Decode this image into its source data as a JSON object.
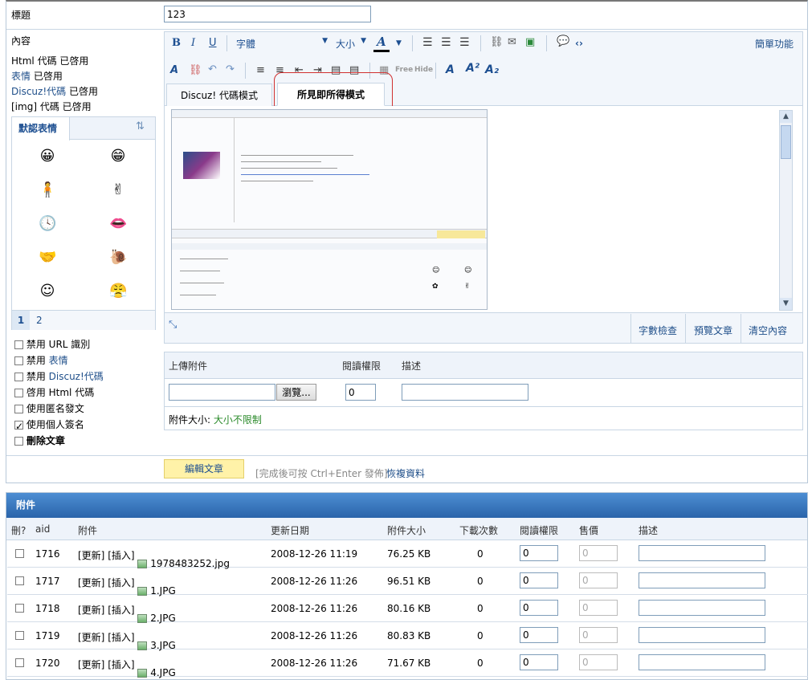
{
  "form": {
    "title_label": "標題",
    "title_value": "123",
    "content_label": "內容",
    "modes": [
      {
        "name": "Html 代碼",
        "status": "已啓用"
      },
      {
        "name": "表情",
        "status": "已啓用"
      },
      {
        "name": "Discuz!代碼",
        "status": "已啓用"
      },
      {
        "name": "[img] 代碼",
        "status": "已啓用"
      }
    ]
  },
  "smilies": {
    "tab_label": "默認表情",
    "icons": [
      "smile-icon",
      "grin-icon",
      "figure-icon",
      "victory-icon",
      "clock-icon",
      "lips-icon",
      "handshake-icon",
      "snail-icon",
      "happy-icon",
      "angry-icon"
    ],
    "pages": [
      "1",
      "2"
    ]
  },
  "options": [
    {
      "pre": "禁用",
      "link": "",
      "text": " URL 識別",
      "checked": false
    },
    {
      "pre": "禁用 ",
      "link": "表情",
      "text": "",
      "checked": false
    },
    {
      "pre": "禁用 ",
      "link": "Discuz!代碼",
      "text": "",
      "checked": false
    },
    {
      "pre": "啓用 Html 代碼",
      "link": "",
      "text": "",
      "checked": false
    },
    {
      "pre": "使用匿名發文",
      "link": "",
      "text": "",
      "checked": false
    },
    {
      "pre": "使用個人簽名",
      "link": "",
      "text": "",
      "checked": true
    },
    {
      "pre": "刪除文章",
      "link": "",
      "text": "",
      "checked": false
    }
  ],
  "editor": {
    "bold": "B",
    "italic": "I",
    "underline": "U",
    "font_label": "字體",
    "size_label": "大小",
    "simple_mode": "簡單功能",
    "tabs": [
      "Discuz! 代碼模式",
      "所見即所得模式"
    ],
    "active_tab": 1,
    "word_count": "字數檢查",
    "preview": "預覽文章",
    "clear": "清空內容"
  },
  "upload": {
    "col_attach": "上傳附件",
    "col_perm": "閱讀權限",
    "col_desc": "描述",
    "browse": "瀏覽...",
    "perm_value": "0",
    "size_label": "附件大小: ",
    "size_value": "大小不限制"
  },
  "submit": {
    "button": "編輯文章",
    "hint": "[完成後可按 Ctrl+Enter 發佈]",
    "restore": "恢複資料"
  },
  "attachments": {
    "title": "附件",
    "headers": [
      "刪?",
      "aid",
      "附件",
      "更新日期",
      "附件大小",
      "下載次數",
      "閱讀權限",
      "售價",
      "描述"
    ],
    "update": "[更新]",
    "insert": "[插入]",
    "rows": [
      {
        "aid": "1716",
        "file": "1978483252.jpg",
        "date": "2008-12-26 11:19",
        "size": "76.25 KB",
        "downloads": "0",
        "perm": "0",
        "price": "0"
      },
      {
        "aid": "1717",
        "file": "1.JPG",
        "date": "2008-12-26 11:26",
        "size": "96.51 KB",
        "downloads": "0",
        "perm": "0",
        "price": "0"
      },
      {
        "aid": "1718",
        "file": "2.JPG",
        "date": "2008-12-26 11:26",
        "size": "80.16 KB",
        "downloads": "0",
        "perm": "0",
        "price": "0"
      },
      {
        "aid": "1719",
        "file": "3.JPG",
        "date": "2008-12-26 11:26",
        "size": "80.83 KB",
        "downloads": "0",
        "perm": "0",
        "price": "0"
      },
      {
        "aid": "1720",
        "file": "4.JPG",
        "date": "2008-12-26 11:26",
        "size": "71.67 KB",
        "downloads": "0",
        "perm": "0",
        "price": "0"
      }
    ]
  },
  "colors": {
    "header_bar": "#2f6fb5",
    "highlight": "#d03030",
    "submit_bg": "#fff2a8"
  }
}
